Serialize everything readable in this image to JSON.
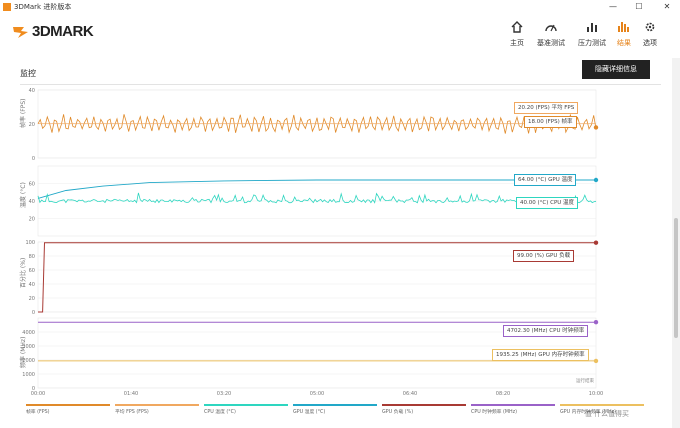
{
  "window": {
    "title": "3DMark 进阶版本",
    "minimize": "—",
    "maximize": "☐",
    "close": "✕"
  },
  "brand": {
    "name": "3DMARK"
  },
  "nav": [
    {
      "label": "主页",
      "icon": "home-icon"
    },
    {
      "label": "基准测试",
      "icon": "gauge-icon"
    },
    {
      "label": "压力测试",
      "icon": "stress-chart-icon"
    },
    {
      "label": "结果",
      "icon": "results-chart-icon",
      "active": true
    },
    {
      "label": "选项",
      "icon": "gear-icon"
    }
  ],
  "page": {
    "title": "监控",
    "hide_button": "隐藏详细信息"
  },
  "colors": {
    "fps": "#e08a2a",
    "avgfps": "#f0a860",
    "cpu": "#2ed6c0",
    "gpu_temp": "#22a8c8",
    "gpu_load": "#a83a34",
    "cpu_clock": "#9a62c8",
    "gpu_clock": "#ecc060"
  },
  "watermark": "值 什么值得买",
  "chart_data": [
    {
      "type": "line",
      "ylabel": "帧率 (FPS)",
      "yticks": [
        0,
        20,
        40
      ],
      "ylim": [
        0,
        40
      ],
      "series": [
        {
          "name": "帧率",
          "values": "oscillating ~15–25 FPS across 0–6 min"
        },
        {
          "name": "平均 FPS",
          "values": [
            20.2
          ]
        }
      ],
      "callouts": [
        "20.20 (FPS) 平均 FPS",
        "18.00 (FPS) 帧率"
      ]
    },
    {
      "type": "line",
      "ylabel": "温度 (°C)",
      "yticks": [
        20,
        40,
        60
      ],
      "ylim": [
        0,
        80
      ],
      "series": [
        {
          "name": "GPU 温度",
          "points": [
            [
              0,
              43
            ],
            [
              0.3,
              52
            ],
            [
              0.7,
              57
            ],
            [
              1.2,
              61
            ],
            [
              2,
              63
            ],
            [
              3,
              64
            ],
            [
              6,
              64
            ]
          ]
        },
        {
          "name": "CPU 温度",
          "values": "fluctuating ~38–44 °C"
        }
      ],
      "callouts": [
        "64.00 (°C) GPU 温度",
        "40.00 (°C) CPU 温度"
      ]
    },
    {
      "type": "line",
      "ylabel": "百分比 (%)",
      "yticks": [
        0,
        20,
        40,
        60,
        80,
        100
      ],
      "ylim": [
        0,
        100
      ],
      "series": [
        {
          "name": "GPU 负载",
          "points": [
            [
              0,
              0
            ],
            [
              0.05,
              0
            ],
            [
              0.07,
              99
            ],
            [
              6,
              99
            ]
          ]
        }
      ],
      "callouts": [
        "99.00 (%) GPU 负载"
      ]
    },
    {
      "type": "line",
      "ylabel": "频率 (MHz)",
      "yticks": [
        0,
        1000,
        2000,
        3000,
        4000
      ],
      "ylim": [
        0,
        5000
      ],
      "series": [
        {
          "name": "CPU 时钟频率",
          "points": [
            [
              0,
              4702.3
            ],
            [
              6,
              4702.3
            ]
          ]
        },
        {
          "name": "GPU 内存时钟频率",
          "points": [
            [
              0,
              1935.25
            ],
            [
              6,
              1935.25
            ]
          ]
        }
      ],
      "callouts": [
        "4702.30 (MHz) CPU 时钟频率",
        "1935.25 (MHz) GPU 内存时钟频率"
      ]
    }
  ],
  "xaxis": {
    "ticks": [
      "00:00",
      "01:40",
      "03:20",
      "05:00",
      "06:40",
      "08:20",
      "10:00"
    ],
    "extra_label": "运行结束"
  },
  "legend": [
    "帧率 (FPS)",
    "平均 FPS (FPS)",
    "CPU 温度 (°C)",
    "GPU 温度 (°C)",
    "GPU 负载 (%)",
    "CPU 时钟频率 (MHz)",
    "GPU 内存时钟频率 (MHz)"
  ]
}
